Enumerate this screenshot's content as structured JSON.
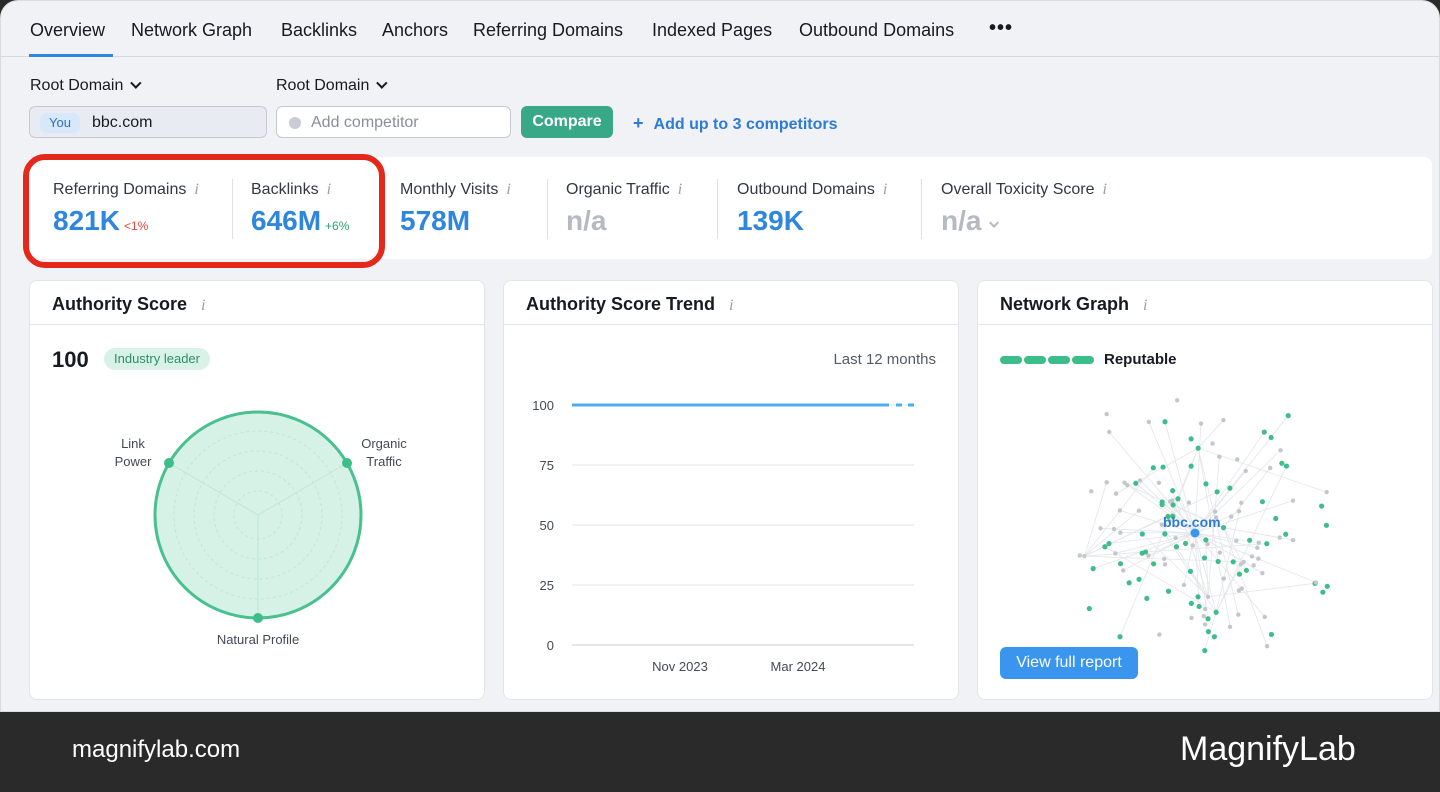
{
  "tabs": [
    {
      "label": "Overview",
      "active": true
    },
    {
      "label": "Network Graph"
    },
    {
      "label": "Backlinks"
    },
    {
      "label": "Anchors"
    },
    {
      "label": "Referring Domains"
    },
    {
      "label": "Indexed Pages"
    },
    {
      "label": "Outbound Domains"
    }
  ],
  "more_icon": "more-dots-icon",
  "controls": {
    "dropdown1_label": "Root Domain",
    "dropdown2_label": "Root Domain",
    "you_badge": "You",
    "domain_value": "bbc.com",
    "competitor_placeholder": "Add competitor",
    "compare_label": "Compare",
    "add_competitors_label": "Add up to 3 competitors"
  },
  "metrics": [
    {
      "label": "Referring Domains",
      "value": "821K",
      "delta": "<1%",
      "delta_type": "negative"
    },
    {
      "label": "Backlinks",
      "value": "646M",
      "delta": "+6%",
      "delta_type": "positive"
    },
    {
      "label": "Monthly Visits",
      "value": "578M"
    },
    {
      "label": "Organic Traffic",
      "value": "n/a"
    },
    {
      "label": "Outbound Domains",
      "value": "139K"
    },
    {
      "label": "Overall Toxicity Score",
      "value": "n/a"
    }
  ],
  "highlight_color": "#e4291c",
  "authority_card": {
    "title": "Authority Score",
    "score": "100",
    "badge": "Industry leader",
    "axes": [
      "Link Power",
      "Organic Traffic",
      "Natural Profile"
    ],
    "axis_lines": {
      "link": [
        "Link",
        "Power"
      ],
      "organic": [
        "Organic",
        "Traffic"
      ],
      "natural": "Natural Profile"
    }
  },
  "trend_card": {
    "title": "Authority Score Trend",
    "subtitle": "Last 12 months"
  },
  "chart_data": {
    "type": "line",
    "x": [
      "Nov 2023",
      "Mar 2024"
    ],
    "xticks": [
      "Nov 2023",
      "Mar 2024"
    ],
    "yticks": [
      0,
      25,
      50,
      75,
      100
    ],
    "ylim": [
      0,
      100
    ],
    "series": [
      {
        "values": [
          100,
          100
        ]
      }
    ],
    "grid": true,
    "color": "#4aaef2"
  },
  "network_card": {
    "title": "Network Graph",
    "status": "Reputable",
    "center_label": "bbc.com",
    "button_label": "View full report"
  },
  "footer": {
    "left": "magnifylab.com",
    "right": "MagnifyLab"
  },
  "colors": {
    "accent_blue": "#2e86de",
    "green": "#38a886",
    "radar_fill": "#d6f1e5",
    "radar_stroke": "#48c08f"
  }
}
